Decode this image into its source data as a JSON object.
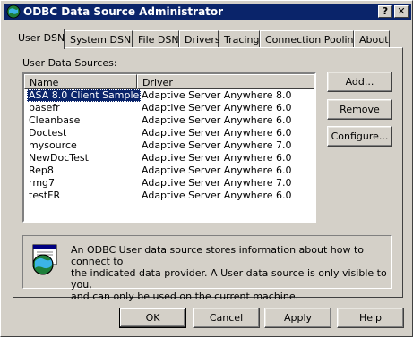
{
  "window": {
    "title": "ODBC Data Source Administrator",
    "help_glyph": "?",
    "close_glyph": "✕"
  },
  "tabs": [
    {
      "label": "User DSN"
    },
    {
      "label": "System DSN"
    },
    {
      "label": "File DSN"
    },
    {
      "label": "Drivers"
    },
    {
      "label": "Tracing"
    },
    {
      "label": "Connection Pooling"
    },
    {
      "label": "About"
    }
  ],
  "user_dsn": {
    "list_label": "User Data Sources:",
    "columns": {
      "name": "Name",
      "driver": "Driver"
    },
    "rows": [
      {
        "name": "ASA 8.0 Client Sample",
        "driver": "Adaptive Server Anywhere 8.0"
      },
      {
        "name": "basefr",
        "driver": "Adaptive Server Anywhere 6.0"
      },
      {
        "name": "Cleanbase",
        "driver": "Adaptive Server Anywhere 6.0"
      },
      {
        "name": "Doctest",
        "driver": "Adaptive Server Anywhere 6.0"
      },
      {
        "name": "mysource",
        "driver": "Adaptive Server Anywhere 7.0"
      },
      {
        "name": "NewDocTest",
        "driver": "Adaptive Server Anywhere 6.0"
      },
      {
        "name": "Rep8",
        "driver": "Adaptive Server Anywhere 6.0"
      },
      {
        "name": "rmg7",
        "driver": "Adaptive Server Anywhere 7.0"
      },
      {
        "name": "testFR",
        "driver": "Adaptive Server Anywhere 6.0"
      }
    ],
    "buttons": {
      "add": "Add...",
      "remove": "Remove",
      "configure": "Configure..."
    },
    "info_lines": [
      "An ODBC User data source stores information about how to connect to",
      "the indicated data provider.   A User data source is only visible to you,",
      "and can only be used on the current machine."
    ]
  },
  "footer": {
    "ok": "OK",
    "cancel": "Cancel",
    "apply": "Apply",
    "help": "Help"
  }
}
